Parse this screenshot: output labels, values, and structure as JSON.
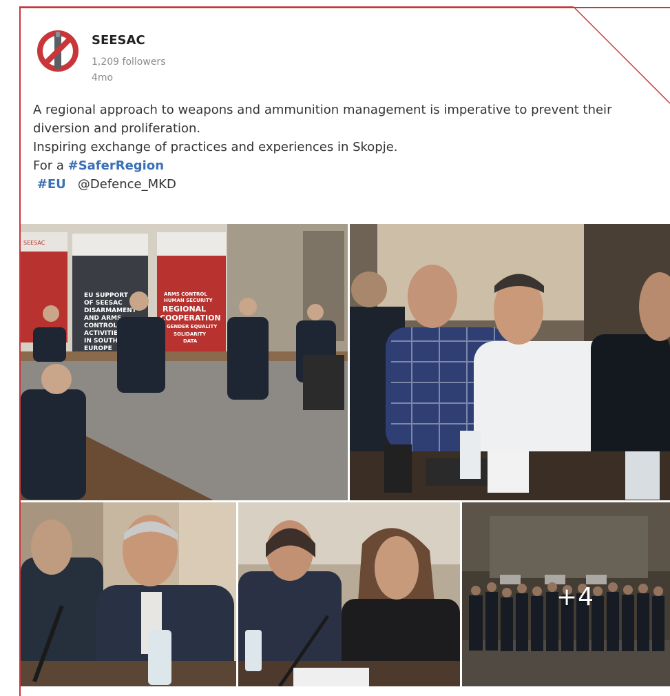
{
  "post": {
    "author": "SEESAC",
    "followers": "1,209 followers",
    "age": "4mo",
    "lines": [
      "A regional approach to weapons and ammunition management is imperative to prevent their",
      "diversion and proliferation.",
      "Inspiring exchange of practices and experiences in Skopje."
    ],
    "for_prefix": "For a ",
    "hashtag_safer": "#SaferRegion",
    "hashtag_eu": "#EU",
    "mention": "@Defence_MKD"
  },
  "gallery": {
    "more_count": "+4",
    "banners": {
      "left": "SEESAC",
      "middle_lines": [
        "EU SUPPORT",
        "OF SEESAC",
        "DISARMAMENT",
        "AND ARMS",
        "CONTROL",
        "ACTIVITIES",
        "IN SOUTH EAST",
        "EUROPE"
      ],
      "right_lines": [
        "ARMS CONTROL",
        "HUMAN SECURITY",
        "REGIONAL",
        "COOPERATION",
        "GENDER EQUALITY",
        "SOLIDARITY",
        "DATA"
      ]
    }
  },
  "colors": {
    "brand_red": "#c8363a",
    "hashtag": "#3b6fb6"
  },
  "icons": {
    "logo": "no-guns-icon"
  }
}
